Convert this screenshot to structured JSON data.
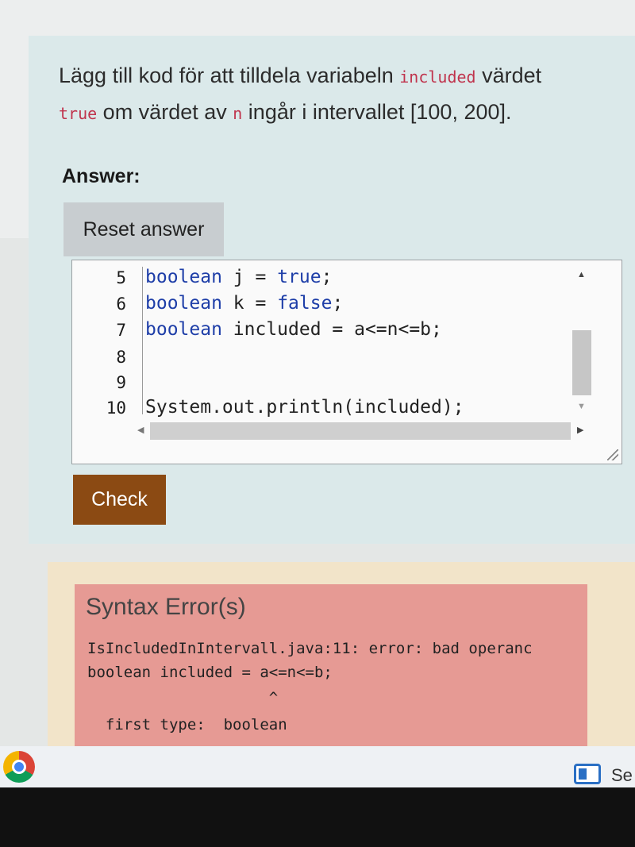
{
  "question": {
    "t1": "Lägg till kod för att tilldela variabeln ",
    "code1": "included",
    "t2": " värdet",
    "code2": "true",
    "t3": " om värdet av ",
    "code3": "n",
    "t4": " ingår i intervallet  [100, 200]."
  },
  "answer_label": "Answer:",
  "reset_label": "Reset answer",
  "editor": {
    "lines": [
      {
        "num": "5",
        "kw1": "boolean",
        "mid": " j = ",
        "kw2": "true",
        "end": ";"
      },
      {
        "num": "6",
        "kw1": "boolean",
        "mid": " k = ",
        "kw2": "false",
        "end": ";"
      },
      {
        "num": "7",
        "kw1": "boolean",
        "mid": " included = a<=n<=b;",
        "kw2": "",
        "end": ""
      },
      {
        "num": "8",
        "kw1": "",
        "mid": "",
        "kw2": "",
        "end": ""
      },
      {
        "num": "9",
        "kw1": "",
        "mid": "",
        "kw2": "",
        "end": ""
      },
      {
        "num": "10",
        "kw1": "",
        "mid": "System.out.println(included);",
        "kw2": "",
        "end": ""
      }
    ]
  },
  "check_label": "Check",
  "error": {
    "title": "Syntax Error(s)",
    "line1": "IsIncludedInIntervall.java:11: error: bad operanc",
    "line2": "boolean included = a<=n<=b;",
    "line3": "                    ^",
    "line4": "  first type:  boolean"
  },
  "taskbar": {
    "search_label": "Se"
  },
  "icons": {
    "browser": "chrome-icon",
    "news": "news-icon"
  }
}
